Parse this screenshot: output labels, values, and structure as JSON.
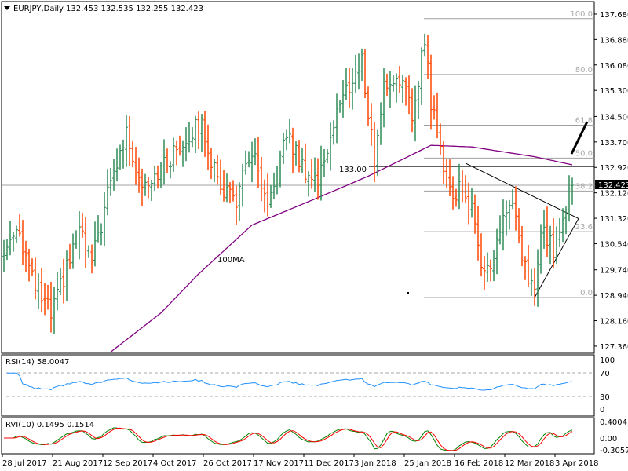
{
  "header": {
    "symbol": "EURJPY,Daily",
    "ohlc": "132.453 132.535 132.255 132.423"
  },
  "price_axis": [
    "137.680",
    "136.880",
    "136.080",
    "135.300",
    "134.500",
    "133.700",
    "132.920",
    "132.120",
    "131.320",
    "130.540",
    "129.740",
    "128.940",
    "128.160",
    "127.360"
  ],
  "current_price": "132.423",
  "date_axis": [
    "28 Jul 2017",
    "21 Aug 2017",
    "12 Sep 2017",
    "4 Oct 2017",
    "26 Oct 2017",
    "17 Nov 2017",
    "11 Dec 2017",
    "3 Jan 2018",
    "25 Jan 2018",
    "16 Feb 2018",
    "12 Mar 2018",
    "3 Apr 2018"
  ],
  "annotations": {
    "level_label": "133.00",
    "level_price": 133.0,
    "ma_label": "100MA"
  },
  "fibonacci": {
    "high": 137.54,
    "low": 128.975,
    "levels": [
      {
        "label": "100.0",
        "ratio": 1.0
      },
      {
        "label": "80.0",
        "ratio": 0.8
      },
      {
        "label": "61.8",
        "ratio": 0.618
      },
      {
        "label": "50.0",
        "ratio": 0.5
      },
      {
        "label": "38.2",
        "ratio": 0.382
      },
      {
        "label": "23.6",
        "ratio": 0.236
      },
      {
        "label": "0.0",
        "ratio": 0.0
      }
    ]
  },
  "rsi": {
    "title": "RSI(14) 58.0047",
    "axis": [
      "100",
      "70",
      "30",
      "0"
    ]
  },
  "rvi": {
    "title": "RVI(10) 0.1495 0.1514",
    "axis": [
      "0.4004",
      "0.00",
      "-0.3057"
    ]
  },
  "colors": {
    "up": "#2e8b57",
    "down": "#ff4500",
    "ma": "#800080",
    "rsi": "#1e90ff",
    "rvi_main": "#008000",
    "rvi_signal": "#ff0000"
  },
  "chart_data": {
    "type": "line",
    "title": "EURJPY,Daily",
    "ylim": [
      127.36,
      137.68
    ],
    "bars": 182,
    "close_anchors": [
      [
        0,
        130.3
      ],
      [
        4,
        131.3
      ],
      [
        9,
        129.5
      ],
      [
        15,
        128.4
      ],
      [
        24,
        131.0
      ],
      [
        28,
        130.0
      ],
      [
        34,
        132.5
      ],
      [
        39,
        134.0
      ],
      [
        44,
        132.5
      ],
      [
        51,
        133.0
      ],
      [
        59,
        134.0
      ],
      [
        63,
        134.3
      ],
      [
        68,
        132.5
      ],
      [
        74,
        132.0
      ],
      [
        79,
        133.5
      ],
      [
        84,
        131.5
      ],
      [
        90,
        134.0
      ],
      [
        95,
        133.0
      ],
      [
        100,
        132.5
      ],
      [
        106,
        134.7
      ],
      [
        110,
        135.5
      ],
      [
        114,
        136.2
      ],
      [
        118,
        133.2
      ],
      [
        121,
        135.5
      ],
      [
        126,
        135.8
      ],
      [
        130,
        134.5
      ],
      [
        134,
        137.0
      ],
      [
        136,
        135.0
      ],
      [
        139,
        133.5
      ],
      [
        143,
        132.0
      ],
      [
        146,
        132.5
      ],
      [
        149,
        131.5
      ],
      [
        152,
        130.2
      ],
      [
        155,
        129.8
      ],
      [
        159,
        131.5
      ],
      [
        162,
        131.8
      ],
      [
        165,
        130.0
      ],
      [
        169,
        129.2
      ],
      [
        171,
        131.0
      ],
      [
        175,
        130.5
      ],
      [
        178,
        131.2
      ],
      [
        180,
        132.5
      ],
      [
        181,
        132.423
      ]
    ],
    "ma100_anchors": [
      [
        34,
        127.3
      ],
      [
        50,
        128.5
      ],
      [
        62,
        129.7
      ],
      [
        79,
        131.2
      ],
      [
        99,
        132.0
      ],
      [
        116,
        132.7
      ],
      [
        136,
        133.65
      ],
      [
        149,
        133.6
      ],
      [
        169,
        133.3
      ],
      [
        181,
        133.05
      ]
    ],
    "trendlines": [
      {
        "from": [
          147,
          133.1
        ],
        "to": [
          183,
          131.4
        ]
      },
      {
        "from": [
          169,
          128.975
        ],
        "to": [
          183,
          131.4
        ]
      }
    ]
  }
}
